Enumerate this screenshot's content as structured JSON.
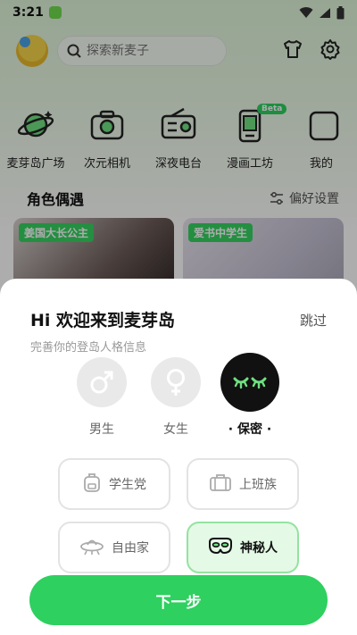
{
  "status_bar": {
    "time": "3:21"
  },
  "header": {
    "search_placeholder": "探索新麦子"
  },
  "quick_menu": [
    {
      "label": "麦芽岛广场",
      "icon": "planet-icon"
    },
    {
      "label": "次元相机",
      "icon": "camera-icon"
    },
    {
      "label": "深夜电台",
      "icon": "radio-icon"
    },
    {
      "label": "漫画工坊",
      "icon": "comic-phone-icon",
      "badge": "Beta"
    },
    {
      "label": "我的",
      "icon": "partial-item-icon"
    }
  ],
  "section": {
    "title": "角色偶遇",
    "preference_label": "偏好设置"
  },
  "cards": [
    {
      "tag": "姜国大长公主"
    },
    {
      "tag": "爱书中学生"
    }
  ],
  "sheet": {
    "title": "Hi 欢迎来到麦芽岛",
    "skip_label": "跳过",
    "subtitle": "完善你的登岛人格信息",
    "genders": [
      {
        "label": "男生",
        "icon": "male-icon"
      },
      {
        "label": "女生",
        "icon": "female-icon"
      },
      {
        "label": "· 保密 ·",
        "icon": "closed-eyes-icon",
        "selected": true
      }
    ],
    "roles": [
      {
        "label": "学生党",
        "icon": "backpack-icon"
      },
      {
        "label": "上班族",
        "icon": "briefcase-icon"
      },
      {
        "label": "自由家",
        "icon": "ufo-icon"
      },
      {
        "label": "神秘人",
        "icon": "mask-icon",
        "selected": true
      }
    ],
    "next_label": "下一步"
  },
  "colors": {
    "accent": "#2ed05f",
    "selected_bg": "#e4f9e6",
    "dark": "#111111"
  }
}
